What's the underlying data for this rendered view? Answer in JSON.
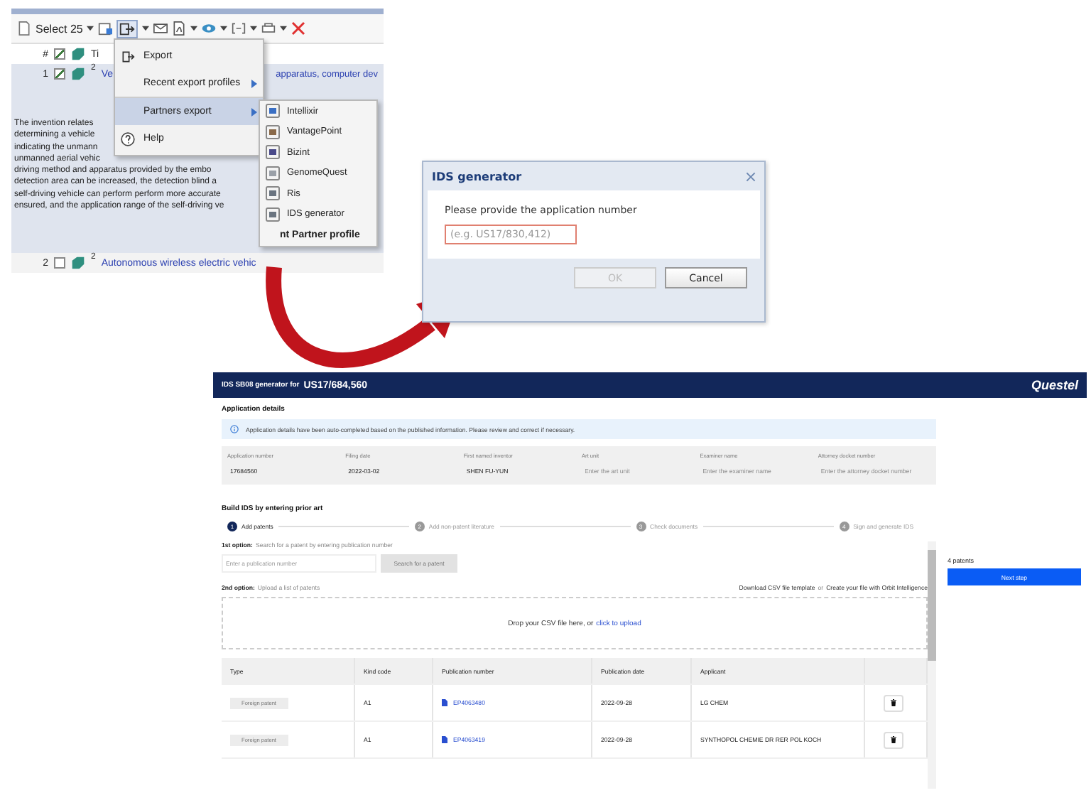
{
  "results_window": {
    "toolbar": {
      "select_label": "Select",
      "select_count": "25"
    },
    "header": {
      "number": "#",
      "checked": true,
      "title": "Ti"
    },
    "rows": [
      {
        "number": "1",
        "checked": true,
        "count": "2",
        "title_start": "Ve",
        "title_end": "apparatus, computer dev"
      },
      {
        "number": "2",
        "checked": false,
        "count": "2",
        "title_start": "Autonomous wireless electric vehic"
      }
    ],
    "abstract_lines": [
      "The invention relates",
      "determining a vehicle",
      "indicating the unmann",
      "unmanned aerial vehic",
      "driving method and apparatus provided by the embo",
      "detection area can be increased, the detection blind a",
      "self-driving vehicle can perform perform more accurate",
      "ensured, and the application range of the self-driving ve"
    ]
  },
  "export_menu": {
    "items": [
      {
        "label": "Export",
        "kind": "icon",
        "selected": false
      },
      {
        "label": "Recent export profiles",
        "kind": "submenu",
        "selected": false
      },
      {
        "label": "Partners export",
        "kind": "submenu",
        "selected": true
      },
      {
        "label": "Help",
        "kind": "help",
        "selected": false
      }
    ]
  },
  "partners_menu": {
    "items": [
      "Intellixir",
      "VantagePoint",
      "Bizint",
      "GenomeQuest",
      "Ris",
      "IDS generator"
    ],
    "cut_item": "nt Partner profile"
  },
  "dialog": {
    "title": "IDS generator",
    "prompt": "Please provide the application number",
    "placeholder": "(e.g. US17/830,412)",
    "buttons": [
      {
        "label": "OK",
        "disabled": true
      },
      {
        "label": "Cancel",
        "disabled": false
      }
    ]
  },
  "ids_app": {
    "title": "IDS SB08 generator for",
    "number": "US17/684,560",
    "logo": "Questel",
    "details_heading": "Application details",
    "notice": "Application details have been auto-completed based on the published information. Please review and correct if necessary.",
    "fields": [
      {
        "label": "Application number",
        "value": "17684560"
      },
      {
        "label": "Filing date",
        "value": "2022-03-02"
      },
      {
        "label": "First named inventor",
        "value": "SHEN FU-YUN"
      },
      {
        "label": "Art unit",
        "placeholder": "Enter the art unit"
      },
      {
        "label": "Examiner name",
        "placeholder": "Enter the examiner name"
      },
      {
        "label": "Attorney docket number",
        "placeholder": "Enter the attorney docket number"
      }
    ],
    "build_heading": "Build IDS by entering prior art",
    "steps": [
      {
        "number": "1",
        "label": "Add patents",
        "selected": true
      },
      {
        "number": "2",
        "label": "Add non-patent literature",
        "selected": false
      },
      {
        "number": "3",
        "label": "Check documents",
        "selected": false
      },
      {
        "number": "4",
        "label": "Sign and generate IDS",
        "selected": false
      }
    ],
    "patent_count": "4 patents",
    "next_button": "Next step",
    "option1": {
      "label": "1st option:",
      "text": "Search for a patent by entering publication number",
      "placeholder": "Enter a publication number",
      "button": "Search for a patent"
    },
    "option2": {
      "label": "2nd option:",
      "text": "Upload a list of patents",
      "link1": "Download CSV file template",
      "or": "or",
      "link2": "Create your file with Orbit Intelligence"
    },
    "dropzone": {
      "text": "Drop your CSV file here, or",
      "link": "click to upload"
    },
    "table": {
      "columns": [
        "Type",
        "Kind code",
        "Publication number",
        "Publication date",
        "Applicant"
      ],
      "rows": [
        {
          "type": "Foreign patent",
          "kind_code": "A1",
          "publication_number": "EP4063480",
          "publication_date": "2022-09-28",
          "applicant": "LG CHEM"
        },
        {
          "type": "Foreign patent",
          "kind_code": "A1",
          "publication_number": "EP4063419",
          "publication_date": "2022-09-28",
          "applicant": "SYNTHOPOL CHEMIE DR RER POL KOCH"
        }
      ]
    }
  }
}
